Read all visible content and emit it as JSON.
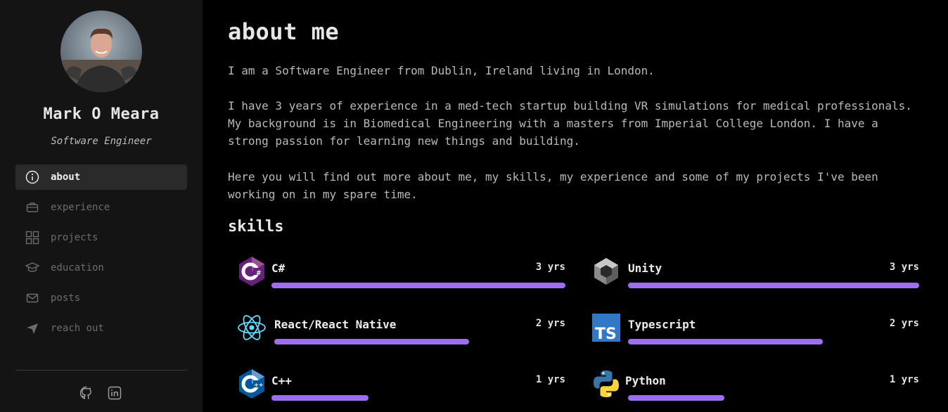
{
  "profile": {
    "name": "Mark O Meara",
    "role": "Software Engineer"
  },
  "nav": [
    {
      "label": "about",
      "icon": "info-icon",
      "active": true
    },
    {
      "label": "experience",
      "icon": "briefcase-icon",
      "active": false
    },
    {
      "label": "projects",
      "icon": "grid-icon",
      "active": false
    },
    {
      "label": "education",
      "icon": "graduation-cap-icon",
      "active": false
    },
    {
      "label": "posts",
      "icon": "mail-icon",
      "active": false
    },
    {
      "label": "reach out",
      "icon": "send-icon",
      "active": false
    }
  ],
  "social": [
    {
      "icon": "github-icon"
    },
    {
      "icon": "linkedin-icon"
    }
  ],
  "about": {
    "title": "about me",
    "p1": "I am a Software Engineer from Dublin, Ireland living in London.",
    "p2_l1": "I have 3 years of experience in a med-tech startup building VR simulations for medical professionals.",
    "p2_l2": "My background is in Biomedical Engineering with a masters from Imperial College London. I have a",
    "p2_l3": "strong passion for learning new things and building.",
    "p3_l1": "Here you will find out more about me, my skills, my experience and some of my projects I've been",
    "p3_l2": "working on in my spare time."
  },
  "skills": {
    "title": "skills",
    "items": [
      {
        "name": "C#",
        "years": "3 yrs",
        "level": 1.0,
        "icon": "csharp-icon"
      },
      {
        "name": "Unity",
        "years": "3 yrs",
        "level": 1.0,
        "icon": "unity-icon"
      },
      {
        "name": "React/React Native",
        "years": "2 yrs",
        "level": 0.67,
        "icon": "react-icon"
      },
      {
        "name": "Typescript",
        "years": "2 yrs",
        "level": 0.67,
        "icon": "typescript-icon"
      },
      {
        "name": "C++",
        "years": "1 yrs",
        "level": 0.33,
        "icon": "cplusplus-icon"
      },
      {
        "name": "Python",
        "years": "1 yrs",
        "level": 0.33,
        "icon": "python-icon"
      }
    ]
  },
  "colors": {
    "accent": "#9c6ff0",
    "sidebar_bg": "#141414",
    "active_item_bg": "#2a2a2a",
    "page_bg": "#000000"
  }
}
